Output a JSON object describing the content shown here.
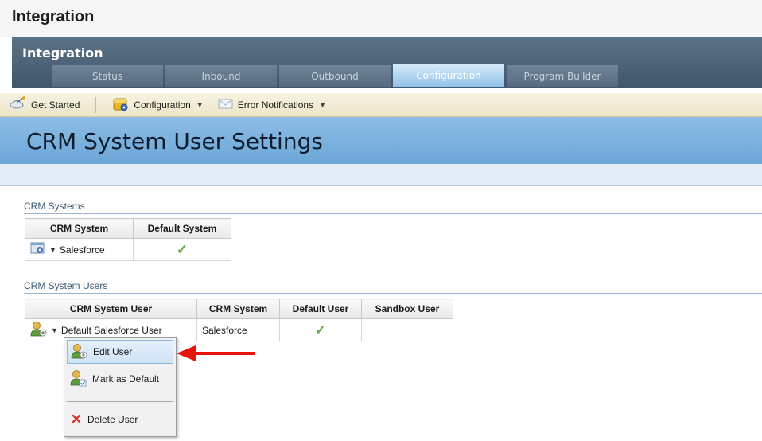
{
  "page": {
    "title": "Integration"
  },
  "module": {
    "title": "Integration",
    "tabs": [
      {
        "label": "Status",
        "active": false
      },
      {
        "label": "Inbound",
        "active": false
      },
      {
        "label": "Outbound",
        "active": false
      },
      {
        "label": "Configuration",
        "active": true
      },
      {
        "label": "Program Builder",
        "active": false
      }
    ]
  },
  "toolbar": {
    "get_started": "Get Started",
    "configuration": "Configuration",
    "error_notifications": "Error Notifications"
  },
  "banner": {
    "title": "CRM System User Settings"
  },
  "crm_systems": {
    "section_label": "CRM Systems",
    "columns": [
      "CRM System",
      "Default System"
    ],
    "rows": [
      {
        "system": "Salesforce",
        "default": true
      }
    ]
  },
  "crm_users": {
    "section_label": "CRM System Users",
    "columns": [
      "CRM System User",
      "CRM System",
      "Default User",
      "Sandbox User"
    ],
    "rows": [
      {
        "user": "Default Salesforce User",
        "system": "Salesforce",
        "default": true,
        "sandbox": false
      }
    ]
  },
  "context_menu": {
    "items": [
      {
        "label": "Edit User",
        "icon": "user-edit-icon",
        "highlighted": true
      },
      {
        "label": "Mark as Default",
        "icon": "user-default-icon",
        "highlighted": false
      },
      {
        "label": "Delete User",
        "icon": "delete-x-icon",
        "highlighted": false
      }
    ]
  },
  "colors": {
    "header_blue": "#3f566b",
    "banner_blue": "#6ba6d7",
    "toolbar_tan": "#ede6c9",
    "check_green": "#6aa84f",
    "annotation_red": "#e8140c"
  }
}
